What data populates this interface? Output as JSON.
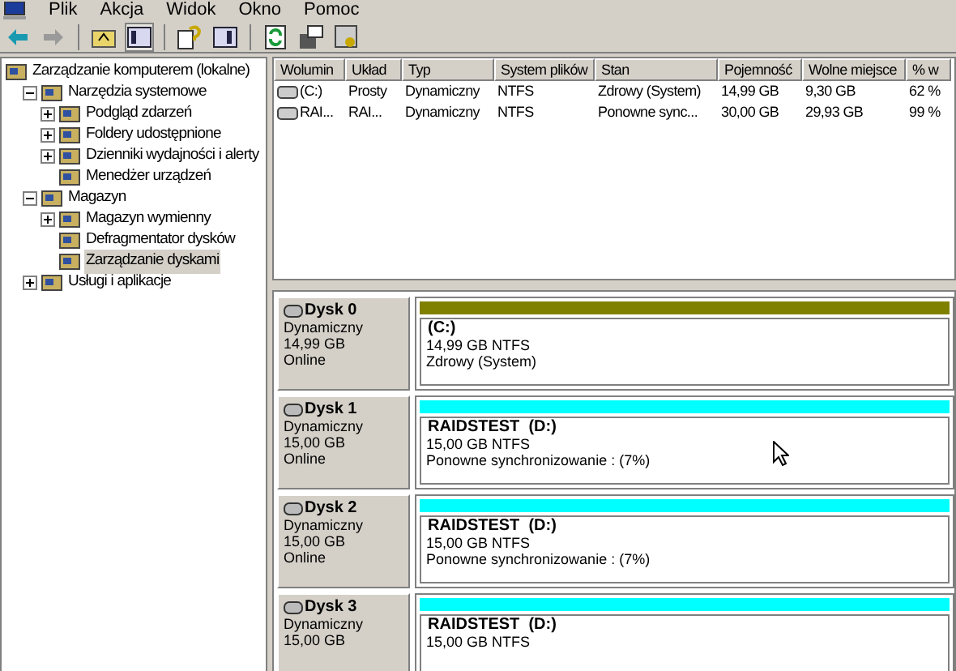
{
  "menu": [
    "Plik",
    "Akcja",
    "Widok",
    "Okno",
    "Pomoc"
  ],
  "tree": [
    {
      "label": "Zarządzanie komputerem (lokalne)",
      "selected": false,
      "children": [
        {
          "label": "Narzędzia systemowe",
          "expanded": true,
          "selected": false,
          "children": [
            {
              "label": "Podgląd zdarzeń",
              "expanded": false,
              "selected": false
            },
            {
              "label": "Foldery udostępnione",
              "expanded": false,
              "selected": false
            },
            {
              "label": "Dzienniki wydajności i alerty",
              "expanded": false,
              "selected": false
            },
            {
              "label": "Menedżer urządzeń",
              "selected": false
            }
          ]
        },
        {
          "label": "Magazyn",
          "expanded": true,
          "selected": false,
          "children": [
            {
              "label": "Magazyn wymienny",
              "expanded": false,
              "selected": false
            },
            {
              "label": "Defragmentator dysków",
              "selected": false
            },
            {
              "label": "Zarządzanie dyskami",
              "selected": true
            }
          ]
        },
        {
          "label": "Usługi i aplikacje",
          "expanded": false,
          "selected": false
        }
      ]
    }
  ],
  "volumes": {
    "columns": [
      "Wolumin",
      "Układ",
      "Typ",
      "System plików",
      "Stan",
      "Pojemność",
      "Wolne miejsce",
      "% w"
    ],
    "rows": [
      [
        "(C:)",
        "Prosty",
        "Dynamiczny",
        "NTFS",
        "Zdrowy (System)",
        "14,99 GB",
        "9,30 GB",
        "62 %"
      ],
      [
        "RAI...",
        "RAI...",
        "Dynamiczny",
        "NTFS",
        "Ponowne sync...",
        "30,00 GB",
        "29,93 GB",
        "99 %"
      ]
    ]
  },
  "disks": [
    {
      "name": "Dysk 0",
      "type": "Dynamiczny",
      "size": "14,99 GB",
      "status": "Online",
      "color": "#808000",
      "partition": {
        "label": "(C:)",
        "detail": "14,99 GB NTFS",
        "status": "Zdrowy (System)"
      }
    },
    {
      "name": "Dysk 1",
      "type": "Dynamiczny",
      "size": "15,00 GB",
      "status": "Online",
      "color": "#00ffff",
      "partition": {
        "label": "RAIDSTEST  (D:)",
        "detail": "15,00 GB NTFS",
        "status": "Ponowne synchronizowanie : (7%)"
      }
    },
    {
      "name": "Dysk 2",
      "type": "Dynamiczny",
      "size": "15,00 GB",
      "status": "Online",
      "color": "#00ffff",
      "partition": {
        "label": "RAIDSTEST  (D:)",
        "detail": "15,00 GB NTFS",
        "status": "Ponowne synchronizowanie : (7%)"
      }
    },
    {
      "name": "Dysk 3",
      "type": "Dynamiczny",
      "size": "15,00 GB",
      "color": "#00ffff",
      "partition": {
        "label": "RAIDSTEST  (D:)",
        "detail": "15,00 GB NTFS"
      }
    }
  ]
}
